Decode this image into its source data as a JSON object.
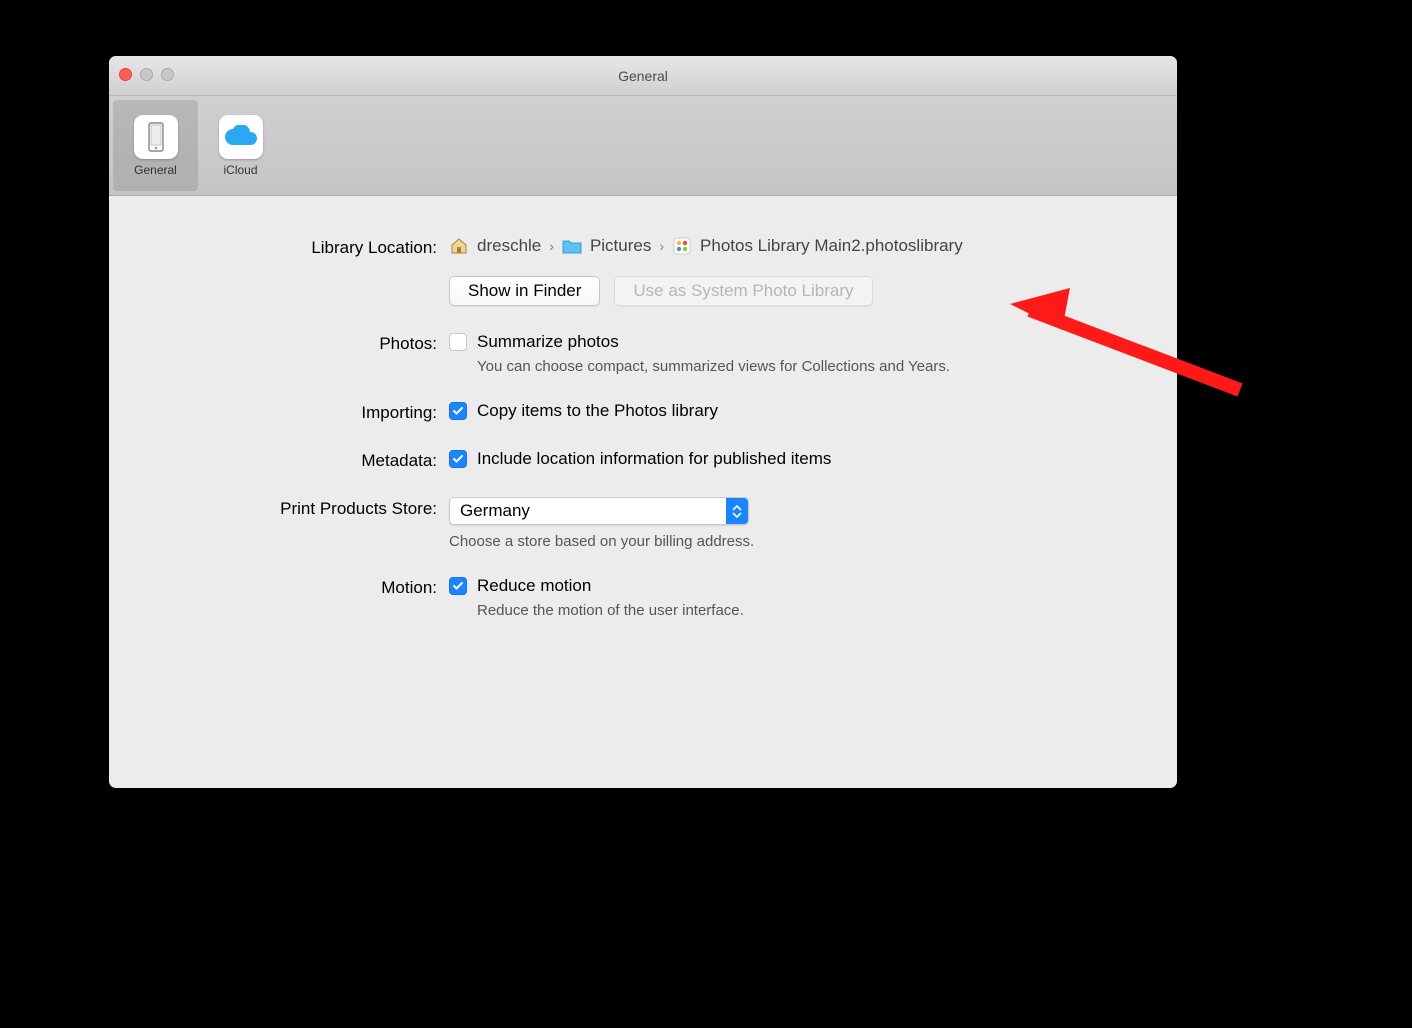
{
  "title": "General",
  "tabs": [
    {
      "label": "General",
      "icon": "general-icon",
      "selected": true
    },
    {
      "label": "iCloud",
      "icon": "icloud-icon",
      "selected": false
    }
  ],
  "labels": {
    "library_location": "Library Location:",
    "photos": "Photos:",
    "importing": "Importing:",
    "metadata": "Metadata:",
    "store": "Print Products Store:",
    "motion": "Motion:"
  },
  "breadcrumbs": [
    "dreschle",
    "Pictures",
    "Photos Library Main2.photoslibrary"
  ],
  "buttons": {
    "show_in_finder": "Show in Finder",
    "use_system": "Use as System Photo Library"
  },
  "photos": {
    "check_label": "Summarize photos",
    "hint": "You can choose compact, summarized views for Collections and Years."
  },
  "importing": {
    "check_label": "Copy items to the Photos library"
  },
  "metadata": {
    "check_label": "Include location information for published items"
  },
  "store": {
    "value": "Germany",
    "hint": "Choose a store based on your billing address."
  },
  "motion": {
    "check_label": "Reduce motion",
    "hint": "Reduce the motion of the user interface."
  },
  "annotation": {
    "arrow_color": "#ff0000"
  }
}
